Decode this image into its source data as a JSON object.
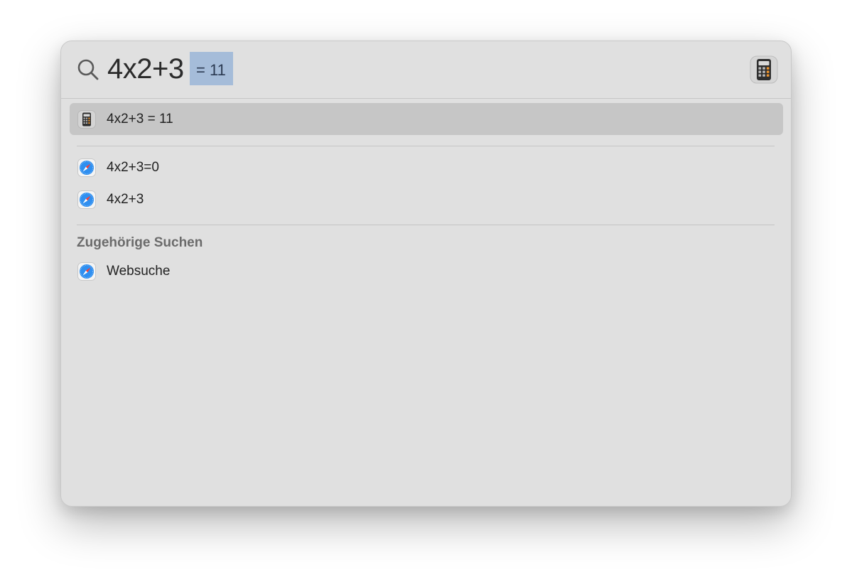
{
  "search": {
    "query": "4x2+3",
    "completion": "= 11"
  },
  "preview": {
    "app_icon": "calculator-icon"
  },
  "results": {
    "top_hit": {
      "icon": "calculator-icon",
      "label": "4x2+3 = 11"
    },
    "web_suggestions": [
      {
        "icon": "safari-icon",
        "label": "4x2+3=0"
      },
      {
        "icon": "safari-icon",
        "label": "4x2+3"
      }
    ],
    "related_section": {
      "header": "Zugehörige Suchen",
      "items": [
        {
          "icon": "safari-icon",
          "label": "Websuche"
        }
      ]
    }
  },
  "colors": {
    "panel_background": "#e0e0e0",
    "selection": "#c6c6c6",
    "completion_highlight": "#a5bcd9"
  }
}
